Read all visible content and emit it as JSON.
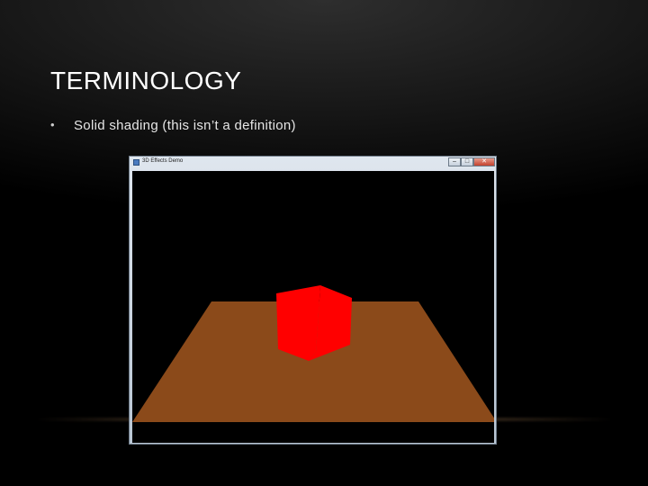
{
  "slide": {
    "title": "TERMINOLOGY",
    "bullets": [
      {
        "marker": "•",
        "text": "Solid shading (this isn’t a definition)"
      }
    ]
  },
  "window": {
    "title": "3D Effects Demo",
    "buttons": {
      "minimize": "–",
      "maximize": "□",
      "close": "✕"
    }
  },
  "scene": {
    "background_color": "#000000",
    "floor_color": "#8b4a1a",
    "cube_front_color": "#ff0000",
    "cube_side_color": "#ff0000"
  }
}
